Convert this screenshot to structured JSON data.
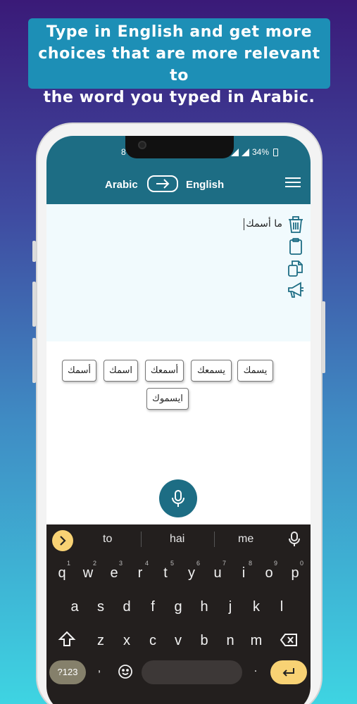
{
  "promo": {
    "line1": "Type in English and get more",
    "line2": "choices that are more relevant to",
    "line3": "the word you typed in Arabic."
  },
  "status": {
    "time_partial": "8",
    "battery": "34%"
  },
  "header": {
    "source_lang": "Arabic",
    "target_lang": "English",
    "swap_icon": "arrow-right-icon",
    "menu_icon": "hamburger-icon"
  },
  "input": {
    "text": "ما أسمك"
  },
  "tools": [
    "trash-icon",
    "clipboard-icon",
    "copy-icon",
    "megaphone-icon"
  ],
  "suggestions": [
    "يسمك",
    "يسمعك",
    "أسمعك",
    "اسمك",
    "أسمك",
    "ايسموك"
  ],
  "keyboard": {
    "suggestion_words": [
      "to",
      "hai",
      "me"
    ],
    "row1": [
      "q",
      "w",
      "e",
      "r",
      "t",
      "y",
      "u",
      "i",
      "o",
      "p"
    ],
    "row1_nums": [
      "1",
      "2",
      "3",
      "4",
      "5",
      "6",
      "7",
      "8",
      "9",
      "0"
    ],
    "row2": [
      "a",
      "s",
      "d",
      "f",
      "g",
      "h",
      "j",
      "k",
      "l"
    ],
    "row3": [
      "z",
      "x",
      "c",
      "v",
      "b",
      "n",
      "m"
    ],
    "symbols_key": "?123",
    "comma": ",",
    "period": "."
  },
  "colors": {
    "header": "#1d6d84",
    "promo_bg": "#1d8fb6",
    "accent_key": "#f8d274"
  }
}
